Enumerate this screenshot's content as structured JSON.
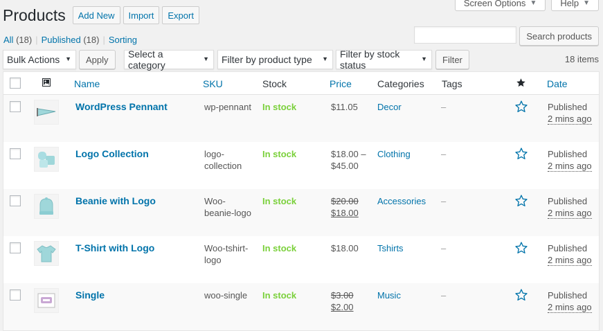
{
  "header": {
    "title": "Products",
    "actions": [
      "Add New",
      "Import",
      "Export"
    ],
    "screen_options": "Screen Options",
    "help": "Help"
  },
  "views": {
    "all_label": "All",
    "all_count": "(18)",
    "published_label": "Published",
    "published_count": "(18)",
    "sorting_label": "Sorting"
  },
  "search": {
    "button": "Search products",
    "value": ""
  },
  "filters": {
    "bulk_actions": "Bulk Actions",
    "apply": "Apply",
    "category": "Select a category",
    "product_type": "Filter by product type",
    "stock_status": "Filter by stock status",
    "filter": "Filter",
    "items_count": "18 items"
  },
  "columns": {
    "name": "Name",
    "sku": "SKU",
    "stock": "Stock",
    "price": "Price",
    "categories": "Categories",
    "tags": "Tags",
    "date": "Date"
  },
  "products": [
    {
      "name": "WordPress Pennant",
      "sku": "wp-pennant",
      "stock": "In stock",
      "price": "$11.05",
      "price_old": "",
      "category": "Decor",
      "tags": "–",
      "status": "Published",
      "ago": "2 mins ago"
    },
    {
      "name": "Logo Collection",
      "sku": "logo-collection",
      "stock": "In stock",
      "price": "$18.00 – $45.00",
      "price_old": "",
      "category": "Clothing",
      "tags": "–",
      "status": "Published",
      "ago": "2 mins ago"
    },
    {
      "name": "Beanie with Logo",
      "sku": "Woo-beanie-logo",
      "stock": "In stock",
      "price": "$18.00",
      "price_old": "$20.00",
      "category": "Accessories",
      "tags": "–",
      "status": "Published",
      "ago": "2 mins ago"
    },
    {
      "name": "T-Shirt with Logo",
      "sku": "Woo-tshirt-logo",
      "stock": "In stock",
      "price": "$18.00",
      "price_old": "",
      "category": "Tshirts",
      "tags": "–",
      "status": "Published",
      "ago": "2 mins ago"
    },
    {
      "name": "Single",
      "sku": "woo-single",
      "stock": "In stock",
      "price": "$2.00",
      "price_old": "$3.00",
      "category": "Music",
      "tags": "–",
      "status": "Published",
      "ago": "2 mins ago"
    }
  ],
  "colors": {
    "link": "#0073aa",
    "in_stock": "#7ad03a",
    "border": "#e5e5e5"
  },
  "icons": {
    "image_column": "image-icon",
    "featured_column": "star-filled-icon",
    "featured_row": "star-outline-icon"
  }
}
